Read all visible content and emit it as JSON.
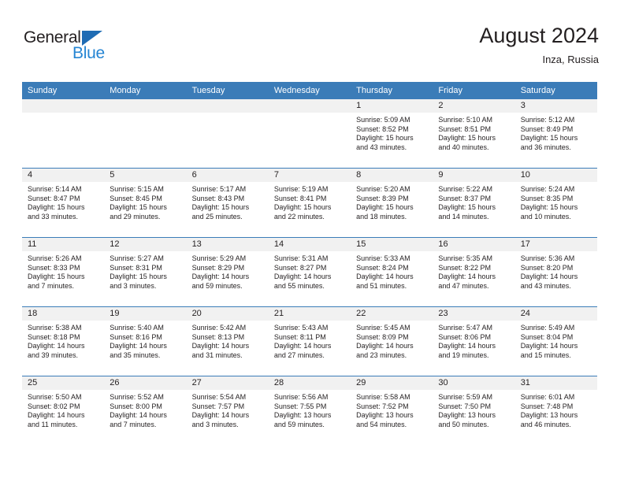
{
  "brand": {
    "name_part1": "General",
    "name_part2": "Blue",
    "accent_color": "#2585d3",
    "triangle_color": "#1f6cb4"
  },
  "header": {
    "title": "August 2024",
    "subtitle": "Inza, Russia"
  },
  "theme": {
    "header_bar": "#3b7cb8",
    "day_band": "#f1f1f1",
    "text": "#231f20"
  },
  "weekdays": [
    "Sunday",
    "Monday",
    "Tuesday",
    "Wednesday",
    "Thursday",
    "Friday",
    "Saturday"
  ],
  "weeks": [
    [
      {
        "day": "",
        "lines": []
      },
      {
        "day": "",
        "lines": []
      },
      {
        "day": "",
        "lines": []
      },
      {
        "day": "",
        "lines": []
      },
      {
        "day": "1",
        "lines": [
          "Sunrise: 5:09 AM",
          "Sunset: 8:52 PM",
          "Daylight: 15 hours",
          "and 43 minutes."
        ]
      },
      {
        "day": "2",
        "lines": [
          "Sunrise: 5:10 AM",
          "Sunset: 8:51 PM",
          "Daylight: 15 hours",
          "and 40 minutes."
        ]
      },
      {
        "day": "3",
        "lines": [
          "Sunrise: 5:12 AM",
          "Sunset: 8:49 PM",
          "Daylight: 15 hours",
          "and 36 minutes."
        ]
      }
    ],
    [
      {
        "day": "4",
        "lines": [
          "Sunrise: 5:14 AM",
          "Sunset: 8:47 PM",
          "Daylight: 15 hours",
          "and 33 minutes."
        ]
      },
      {
        "day": "5",
        "lines": [
          "Sunrise: 5:15 AM",
          "Sunset: 8:45 PM",
          "Daylight: 15 hours",
          "and 29 minutes."
        ]
      },
      {
        "day": "6",
        "lines": [
          "Sunrise: 5:17 AM",
          "Sunset: 8:43 PM",
          "Daylight: 15 hours",
          "and 25 minutes."
        ]
      },
      {
        "day": "7",
        "lines": [
          "Sunrise: 5:19 AM",
          "Sunset: 8:41 PM",
          "Daylight: 15 hours",
          "and 22 minutes."
        ]
      },
      {
        "day": "8",
        "lines": [
          "Sunrise: 5:20 AM",
          "Sunset: 8:39 PM",
          "Daylight: 15 hours",
          "and 18 minutes."
        ]
      },
      {
        "day": "9",
        "lines": [
          "Sunrise: 5:22 AM",
          "Sunset: 8:37 PM",
          "Daylight: 15 hours",
          "and 14 minutes."
        ]
      },
      {
        "day": "10",
        "lines": [
          "Sunrise: 5:24 AM",
          "Sunset: 8:35 PM",
          "Daylight: 15 hours",
          "and 10 minutes."
        ]
      }
    ],
    [
      {
        "day": "11",
        "lines": [
          "Sunrise: 5:26 AM",
          "Sunset: 8:33 PM",
          "Daylight: 15 hours",
          "and 7 minutes."
        ]
      },
      {
        "day": "12",
        "lines": [
          "Sunrise: 5:27 AM",
          "Sunset: 8:31 PM",
          "Daylight: 15 hours",
          "and 3 minutes."
        ]
      },
      {
        "day": "13",
        "lines": [
          "Sunrise: 5:29 AM",
          "Sunset: 8:29 PM",
          "Daylight: 14 hours",
          "and 59 minutes."
        ]
      },
      {
        "day": "14",
        "lines": [
          "Sunrise: 5:31 AM",
          "Sunset: 8:27 PM",
          "Daylight: 14 hours",
          "and 55 minutes."
        ]
      },
      {
        "day": "15",
        "lines": [
          "Sunrise: 5:33 AM",
          "Sunset: 8:24 PM",
          "Daylight: 14 hours",
          "and 51 minutes."
        ]
      },
      {
        "day": "16",
        "lines": [
          "Sunrise: 5:35 AM",
          "Sunset: 8:22 PM",
          "Daylight: 14 hours",
          "and 47 minutes."
        ]
      },
      {
        "day": "17",
        "lines": [
          "Sunrise: 5:36 AM",
          "Sunset: 8:20 PM",
          "Daylight: 14 hours",
          "and 43 minutes."
        ]
      }
    ],
    [
      {
        "day": "18",
        "lines": [
          "Sunrise: 5:38 AM",
          "Sunset: 8:18 PM",
          "Daylight: 14 hours",
          "and 39 minutes."
        ]
      },
      {
        "day": "19",
        "lines": [
          "Sunrise: 5:40 AM",
          "Sunset: 8:16 PM",
          "Daylight: 14 hours",
          "and 35 minutes."
        ]
      },
      {
        "day": "20",
        "lines": [
          "Sunrise: 5:42 AM",
          "Sunset: 8:13 PM",
          "Daylight: 14 hours",
          "and 31 minutes."
        ]
      },
      {
        "day": "21",
        "lines": [
          "Sunrise: 5:43 AM",
          "Sunset: 8:11 PM",
          "Daylight: 14 hours",
          "and 27 minutes."
        ]
      },
      {
        "day": "22",
        "lines": [
          "Sunrise: 5:45 AM",
          "Sunset: 8:09 PM",
          "Daylight: 14 hours",
          "and 23 minutes."
        ]
      },
      {
        "day": "23",
        "lines": [
          "Sunrise: 5:47 AM",
          "Sunset: 8:06 PM",
          "Daylight: 14 hours",
          "and 19 minutes."
        ]
      },
      {
        "day": "24",
        "lines": [
          "Sunrise: 5:49 AM",
          "Sunset: 8:04 PM",
          "Daylight: 14 hours",
          "and 15 minutes."
        ]
      }
    ],
    [
      {
        "day": "25",
        "lines": [
          "Sunrise: 5:50 AM",
          "Sunset: 8:02 PM",
          "Daylight: 14 hours",
          "and 11 minutes."
        ]
      },
      {
        "day": "26",
        "lines": [
          "Sunrise: 5:52 AM",
          "Sunset: 8:00 PM",
          "Daylight: 14 hours",
          "and 7 minutes."
        ]
      },
      {
        "day": "27",
        "lines": [
          "Sunrise: 5:54 AM",
          "Sunset: 7:57 PM",
          "Daylight: 14 hours",
          "and 3 minutes."
        ]
      },
      {
        "day": "28",
        "lines": [
          "Sunrise: 5:56 AM",
          "Sunset: 7:55 PM",
          "Daylight: 13 hours",
          "and 59 minutes."
        ]
      },
      {
        "day": "29",
        "lines": [
          "Sunrise: 5:58 AM",
          "Sunset: 7:52 PM",
          "Daylight: 13 hours",
          "and 54 minutes."
        ]
      },
      {
        "day": "30",
        "lines": [
          "Sunrise: 5:59 AM",
          "Sunset: 7:50 PM",
          "Daylight: 13 hours",
          "and 50 minutes."
        ]
      },
      {
        "day": "31",
        "lines": [
          "Sunrise: 6:01 AM",
          "Sunset: 7:48 PM",
          "Daylight: 13 hours",
          "and 46 minutes."
        ]
      }
    ]
  ]
}
